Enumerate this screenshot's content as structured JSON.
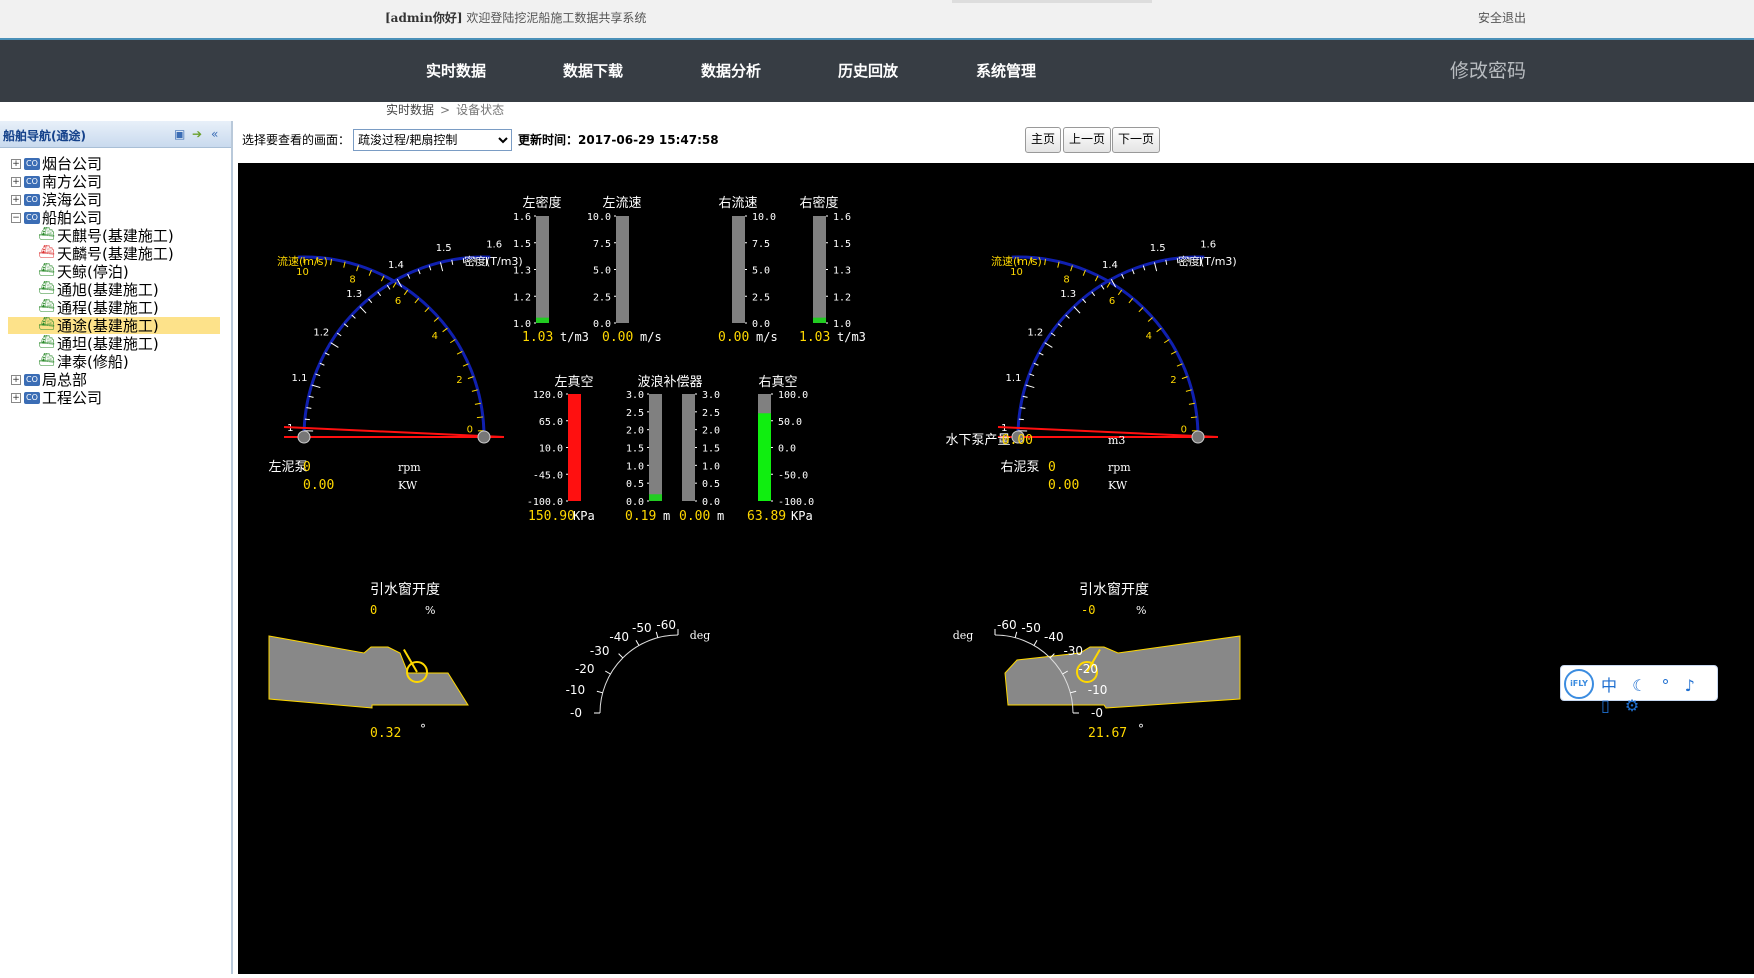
{
  "header": {
    "greeting_user": "[admin你好]",
    "greeting_text": "欢迎登陆挖泥船施工数据共享系统",
    "logout": "安全退出"
  },
  "nav": {
    "items": [
      "实时数据",
      "数据下载",
      "数据分析",
      "历史回放",
      "系统管理"
    ],
    "change_password": "修改密码"
  },
  "breadcrumb": {
    "root": "实时数据",
    "sep": ">",
    "current": "设备状态"
  },
  "sidebar": {
    "title": "船舶导航(通途)",
    "tree": [
      {
        "label": "烟台公司",
        "level": 0,
        "expandable": true,
        "icon": "company-icon"
      },
      {
        "label": "南方公司",
        "level": 0,
        "expandable": true,
        "icon": "company-icon"
      },
      {
        "label": "滨海公司",
        "level": 0,
        "expandable": true,
        "icon": "company-icon"
      },
      {
        "label": "船舶公司",
        "level": 0,
        "expandable": true,
        "expanded": true,
        "icon": "company-icon"
      },
      {
        "label": "天麒号(基建施工)",
        "level": 1,
        "icon": "ship-icon"
      },
      {
        "label": "天麟号(基建施工)",
        "level": 1,
        "icon": "ship-icon",
        "color": "#d33"
      },
      {
        "label": "天鲸(停泊)",
        "level": 1,
        "icon": "ship-icon"
      },
      {
        "label": "通旭(基建施工)",
        "level": 1,
        "icon": "ship-icon"
      },
      {
        "label": "通程(基建施工)",
        "level": 1,
        "icon": "ship-icon"
      },
      {
        "label": "通途(基建施工)",
        "level": 1,
        "icon": "ship-icon",
        "selected": true
      },
      {
        "label": "通坦(基建施工)",
        "level": 1,
        "icon": "ship-icon"
      },
      {
        "label": "津泰(修船)",
        "level": 1,
        "icon": "ship-icon"
      },
      {
        "label": "局总部",
        "level": 0,
        "expandable": true,
        "icon": "company-icon"
      },
      {
        "label": "工程公司",
        "level": 0,
        "expandable": true,
        "icon": "company-icon"
      }
    ]
  },
  "toolbar": {
    "select_label": "选择要查看的画面：",
    "select_value": "疏浚过程/耙扇控制",
    "update_label": "更新时间：2017-06-29 15:47:58",
    "buttons": [
      "主页",
      "上一页",
      "下一页"
    ]
  },
  "dashboard": {
    "left_gauge": {
      "flow_label": "流速(m/s)",
      "density_label": "密度(T/m3)",
      "flow_ticks": [
        "0",
        "2",
        "4",
        "6",
        "8",
        "10"
      ],
      "density_ticks": [
        "1",
        "1.1",
        "1.2",
        "1.3",
        "1.4",
        "1.5",
        "1.6"
      ]
    },
    "right_gauge": {
      "flow_label": "流速(m/s)",
      "density_label": "密度(T/m3)",
      "flow_ticks": [
        "0",
        "2",
        "4",
        "6",
        "8",
        "10"
      ],
      "density_ticks": [
        "1",
        "1.1",
        "1.2",
        "1.3",
        "1.4",
        "1.5",
        "1.6"
      ]
    },
    "bars_top": [
      {
        "title": "左密度",
        "ticks": [
          "1.6",
          "1.5",
          "1.3",
          "1.2",
          "1.0"
        ],
        "value": "1.03",
        "unit": "t/m3",
        "fill": 0.05,
        "color": "#22cc22"
      },
      {
        "title": "左流速",
        "ticks": [
          "10.0",
          "7.5",
          "5.0",
          "2.5",
          "0.0"
        ],
        "value": "0.00",
        "unit": "m/s",
        "fill": 0,
        "color": "#22cc22"
      },
      {
        "title": "右流速",
        "ticks": [
          "10.0",
          "7.5",
          "5.0",
          "2.5",
          "0.0"
        ],
        "value": "0.00",
        "unit": "m/s",
        "fill": 0,
        "color": "#22cc22"
      },
      {
        "title": "右密度",
        "ticks": [
          "1.6",
          "1.5",
          "1.3",
          "1.2",
          "1.0"
        ],
        "value": "1.03",
        "unit": "t/m3",
        "fill": 0.05,
        "color": "#22cc22"
      }
    ],
    "vacuum_left": {
      "title": "左真空",
      "ticks": [
        "120.0",
        "65.0",
        "10.0",
        "-45.0",
        "-100.0"
      ],
      "value": "150.90",
      "unit": "KPa",
      "fill": 1.0,
      "color": "#ff1010"
    },
    "wave_comp": {
      "title": "波浪补偿器",
      "ticks": [
        "3.0",
        "2.5",
        "2.0",
        "1.5",
        "1.0",
        "0.5",
        "0.0"
      ],
      "left_value": "0.19",
      "right_value": "0.00",
      "unit": "m",
      "left_fill": 0.063,
      "right_fill": 0
    },
    "vacuum_right": {
      "title": "右真空",
      "ticks": [
        "100.0",
        "50.0",
        "0.0",
        "-50.0",
        "-100.0"
      ],
      "value": "63.89",
      "unit": "KPa",
      "fill": 0.82,
      "color": "#10ee10"
    },
    "left_pump": {
      "label": "左泥泵",
      "rpm": "0",
      "rpm_unit": "rpm",
      "kw": "0.00",
      "kw_unit": "KW"
    },
    "right_pump": {
      "label": "右泥泵",
      "rpm": "0",
      "rpm_unit": "rpm",
      "kw": "0.00",
      "kw_unit": "KW"
    },
    "underwater_pump": {
      "label": "水下泵产量",
      "value": "0.00",
      "unit": "m3"
    },
    "left_window": {
      "label": "引水窗开度",
      "value": "0",
      "unit": "%",
      "angle": "0.32",
      "angle_unit": "°",
      "deg": "deg",
      "ticks": [
        "-60",
        "-50",
        "-40",
        "-30",
        "-20",
        "-10",
        "-0"
      ]
    },
    "right_window": {
      "label": "引水窗开度",
      "value": "-0",
      "unit": "%",
      "angle": "21.67",
      "angle_unit": "°",
      "deg": "deg",
      "ticks": [
        "-60",
        "-50",
        "-40",
        "-30",
        "-20",
        "-10",
        "-0"
      ]
    }
  },
  "ifly": {
    "logo": "iFLY",
    "icons": "中 ☾ ° ♪ ▯ ⚙"
  }
}
